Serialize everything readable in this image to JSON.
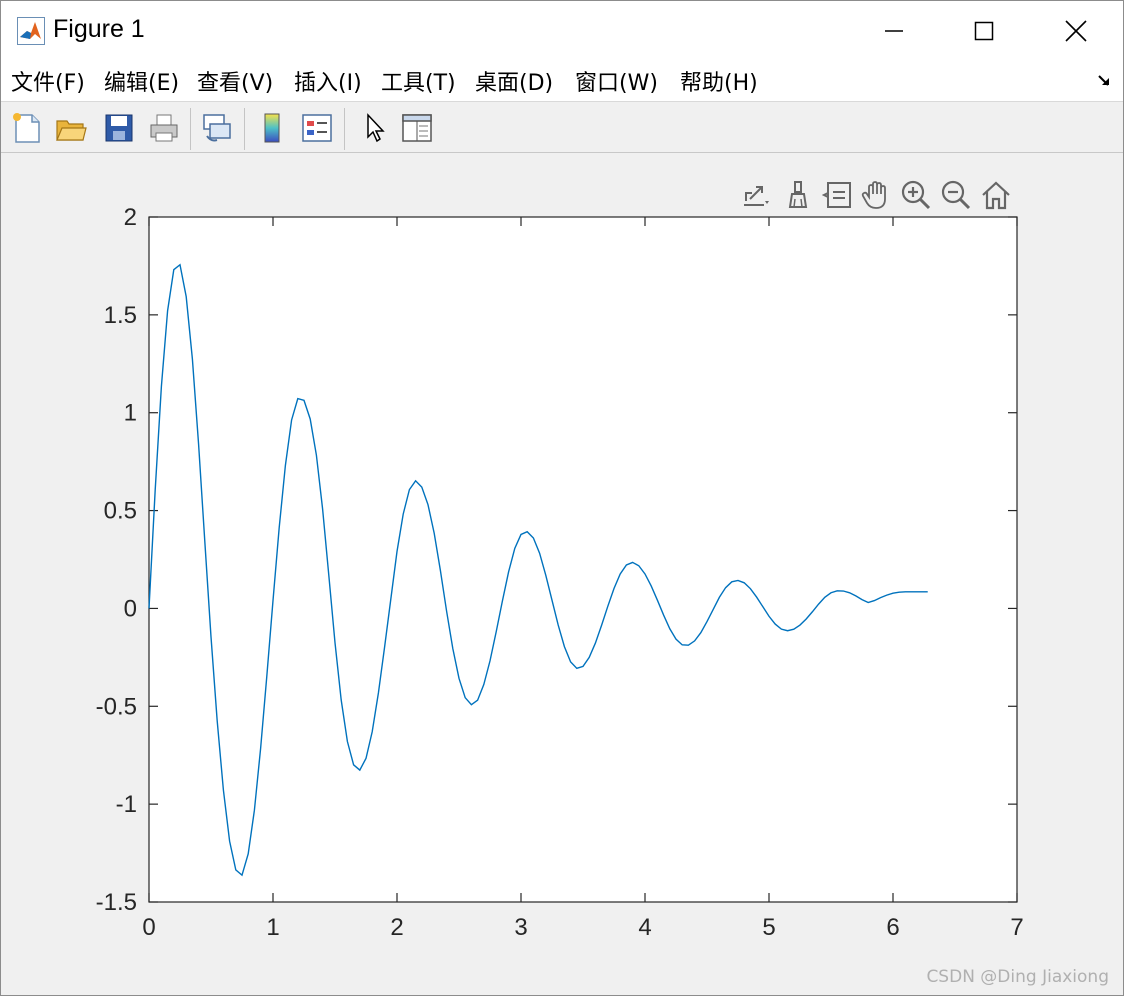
{
  "window": {
    "title": "Figure 1"
  },
  "menu": [
    {
      "label": "文件(F)"
    },
    {
      "label": "编辑(E)"
    },
    {
      "label": "查看(V)"
    },
    {
      "label": "插入(I)"
    },
    {
      "label": "工具(T)"
    },
    {
      "label": "桌面(D)"
    },
    {
      "label": "窗口(W)"
    },
    {
      "label": "帮助(H)"
    }
  ],
  "toolbar": [
    {
      "icon": "new-figure-icon"
    },
    {
      "icon": "open-file-icon"
    },
    {
      "icon": "save-icon"
    },
    {
      "icon": "print-icon"
    },
    {
      "icon": "link-plot-icon"
    },
    {
      "icon": "colorbar-icon"
    },
    {
      "icon": "legend-icon"
    },
    {
      "icon": "edit-plot-cursor-icon"
    },
    {
      "icon": "property-inspector-icon"
    }
  ],
  "axes_toolbar": [
    {
      "icon": "export-icon"
    },
    {
      "icon": "brush-icon"
    },
    {
      "icon": "data-tips-icon"
    },
    {
      "icon": "pan-hand-icon"
    },
    {
      "icon": "zoom-in-icon"
    },
    {
      "icon": "zoom-out-icon"
    },
    {
      "icon": "restore-view-home-icon"
    }
  ],
  "chart_data": {
    "type": "line",
    "title": "",
    "xlabel": "",
    "ylabel": "",
    "xlim": [
      0,
      7
    ],
    "ylim": [
      -1.5,
      2
    ],
    "xticks": [
      0,
      1,
      2,
      3,
      4,
      5,
      6,
      7
    ],
    "xtick_labels": [
      "0",
      "1",
      "2",
      "3",
      "4",
      "5",
      "6",
      "7"
    ],
    "yticks": [
      -1.5,
      -1,
      -0.5,
      0,
      0.5,
      1,
      1.5,
      2
    ],
    "ytick_labels": [
      "-1.5",
      "-1",
      "-0.5",
      "0",
      "0.5",
      "1",
      "1.5",
      "2"
    ],
    "grid": false,
    "line_color": "#0072BD",
    "series": [
      {
        "x": [
          0,
          0.05,
          0.1,
          0.15,
          0.2,
          0.25,
          0.3,
          0.35,
          0.4,
          0.45,
          0.5,
          0.55,
          0.6,
          0.65,
          0.7,
          0.75,
          0.8,
          0.85,
          0.9,
          0.95,
          1.0,
          1.05,
          1.1,
          1.15,
          1.2,
          1.25,
          1.3,
          1.35,
          1.4,
          1.45,
          1.5,
          1.55,
          1.6,
          1.65,
          1.7,
          1.75,
          1.8,
          1.85,
          1.9,
          1.95,
          2.0,
          2.05,
          2.1,
          2.15,
          2.2,
          2.25,
          2.3,
          2.35,
          2.4,
          2.45,
          2.5,
          2.55,
          2.6,
          2.65,
          2.7,
          2.75,
          2.8,
          2.85,
          2.9,
          2.95,
          3.0,
          3.05,
          3.1,
          3.15,
          3.2,
          3.25,
          3.3,
          3.35,
          3.4,
          3.45,
          3.5,
          3.55,
          3.6,
          3.65,
          3.7,
          3.75,
          3.8,
          3.85,
          3.9,
          3.95,
          4.0,
          4.05,
          4.1,
          4.15,
          4.2,
          4.25,
          4.3,
          4.35,
          4.4,
          4.45,
          4.5,
          4.55,
          4.6,
          4.65,
          4.7,
          4.75,
          4.8,
          4.85,
          4.9,
          4.95,
          5.0,
          5.05,
          5.1,
          5.15,
          5.2,
          5.25,
          5.3,
          5.35,
          5.4,
          5.45,
          5.5,
          5.55,
          5.6,
          5.65,
          5.7,
          5.75,
          5.8,
          5.85,
          5.9,
          5.95,
          6.0,
          6.05,
          6.1,
          6.15,
          6.2,
          6.25,
          6.28
        ],
        "y": [
          0,
          0.606,
          1.135,
          1.521,
          1.731,
          1.756,
          1.593,
          1.274,
          0.838,
          0.343,
          -0.145,
          -0.575,
          -0.928,
          -1.189,
          -1.336,
          -1.363,
          -1.254,
          -1.031,
          -0.716,
          -0.347,
          0.04,
          0.413,
          0.731,
          0.963,
          1.072,
          1.063,
          0.968,
          0.783,
          0.508,
          0.17,
          -0.175,
          -0.468,
          -0.68,
          -0.799,
          -0.826,
          -0.766,
          -0.63,
          -0.432,
          -0.197,
          0.047,
          0.291,
          0.482,
          0.607,
          0.652,
          0.62,
          0.53,
          0.384,
          0.194,
          -0.014,
          -0.205,
          -0.357,
          -0.456,
          -0.492,
          -0.469,
          -0.389,
          -0.268,
          -0.119,
          0.038,
          0.187,
          0.307,
          0.378,
          0.392,
          0.36,
          0.282,
          0.169,
          0.042,
          -0.085,
          -0.195,
          -0.273,
          -0.306,
          -0.296,
          -0.25,
          -0.177,
          -0.086,
          0.011,
          0.102,
          0.176,
          0.222,
          0.235,
          0.218,
          0.176,
          0.115,
          0.042,
          -0.034,
          -0.104,
          -0.157,
          -0.186,
          -0.188,
          -0.166,
          -0.124,
          -0.067,
          -0.005,
          0.057,
          0.106,
          0.136,
          0.143,
          0.131,
          0.101,
          0.058,
          0.009,
          -0.04,
          -0.08,
          -0.106,
          -0.114,
          -0.106,
          -0.085,
          -0.054,
          -0.017,
          0.022,
          0.057,
          0.08,
          0.09,
          0.089,
          0.08,
          0.064,
          0.045,
          0.03,
          0.04,
          0.055,
          0.068,
          0.078,
          0.083,
          0.085,
          0.085,
          0.085,
          0.085,
          0.085
        ]
      }
    ]
  },
  "watermark": "CSDN @Ding Jiaxiong"
}
